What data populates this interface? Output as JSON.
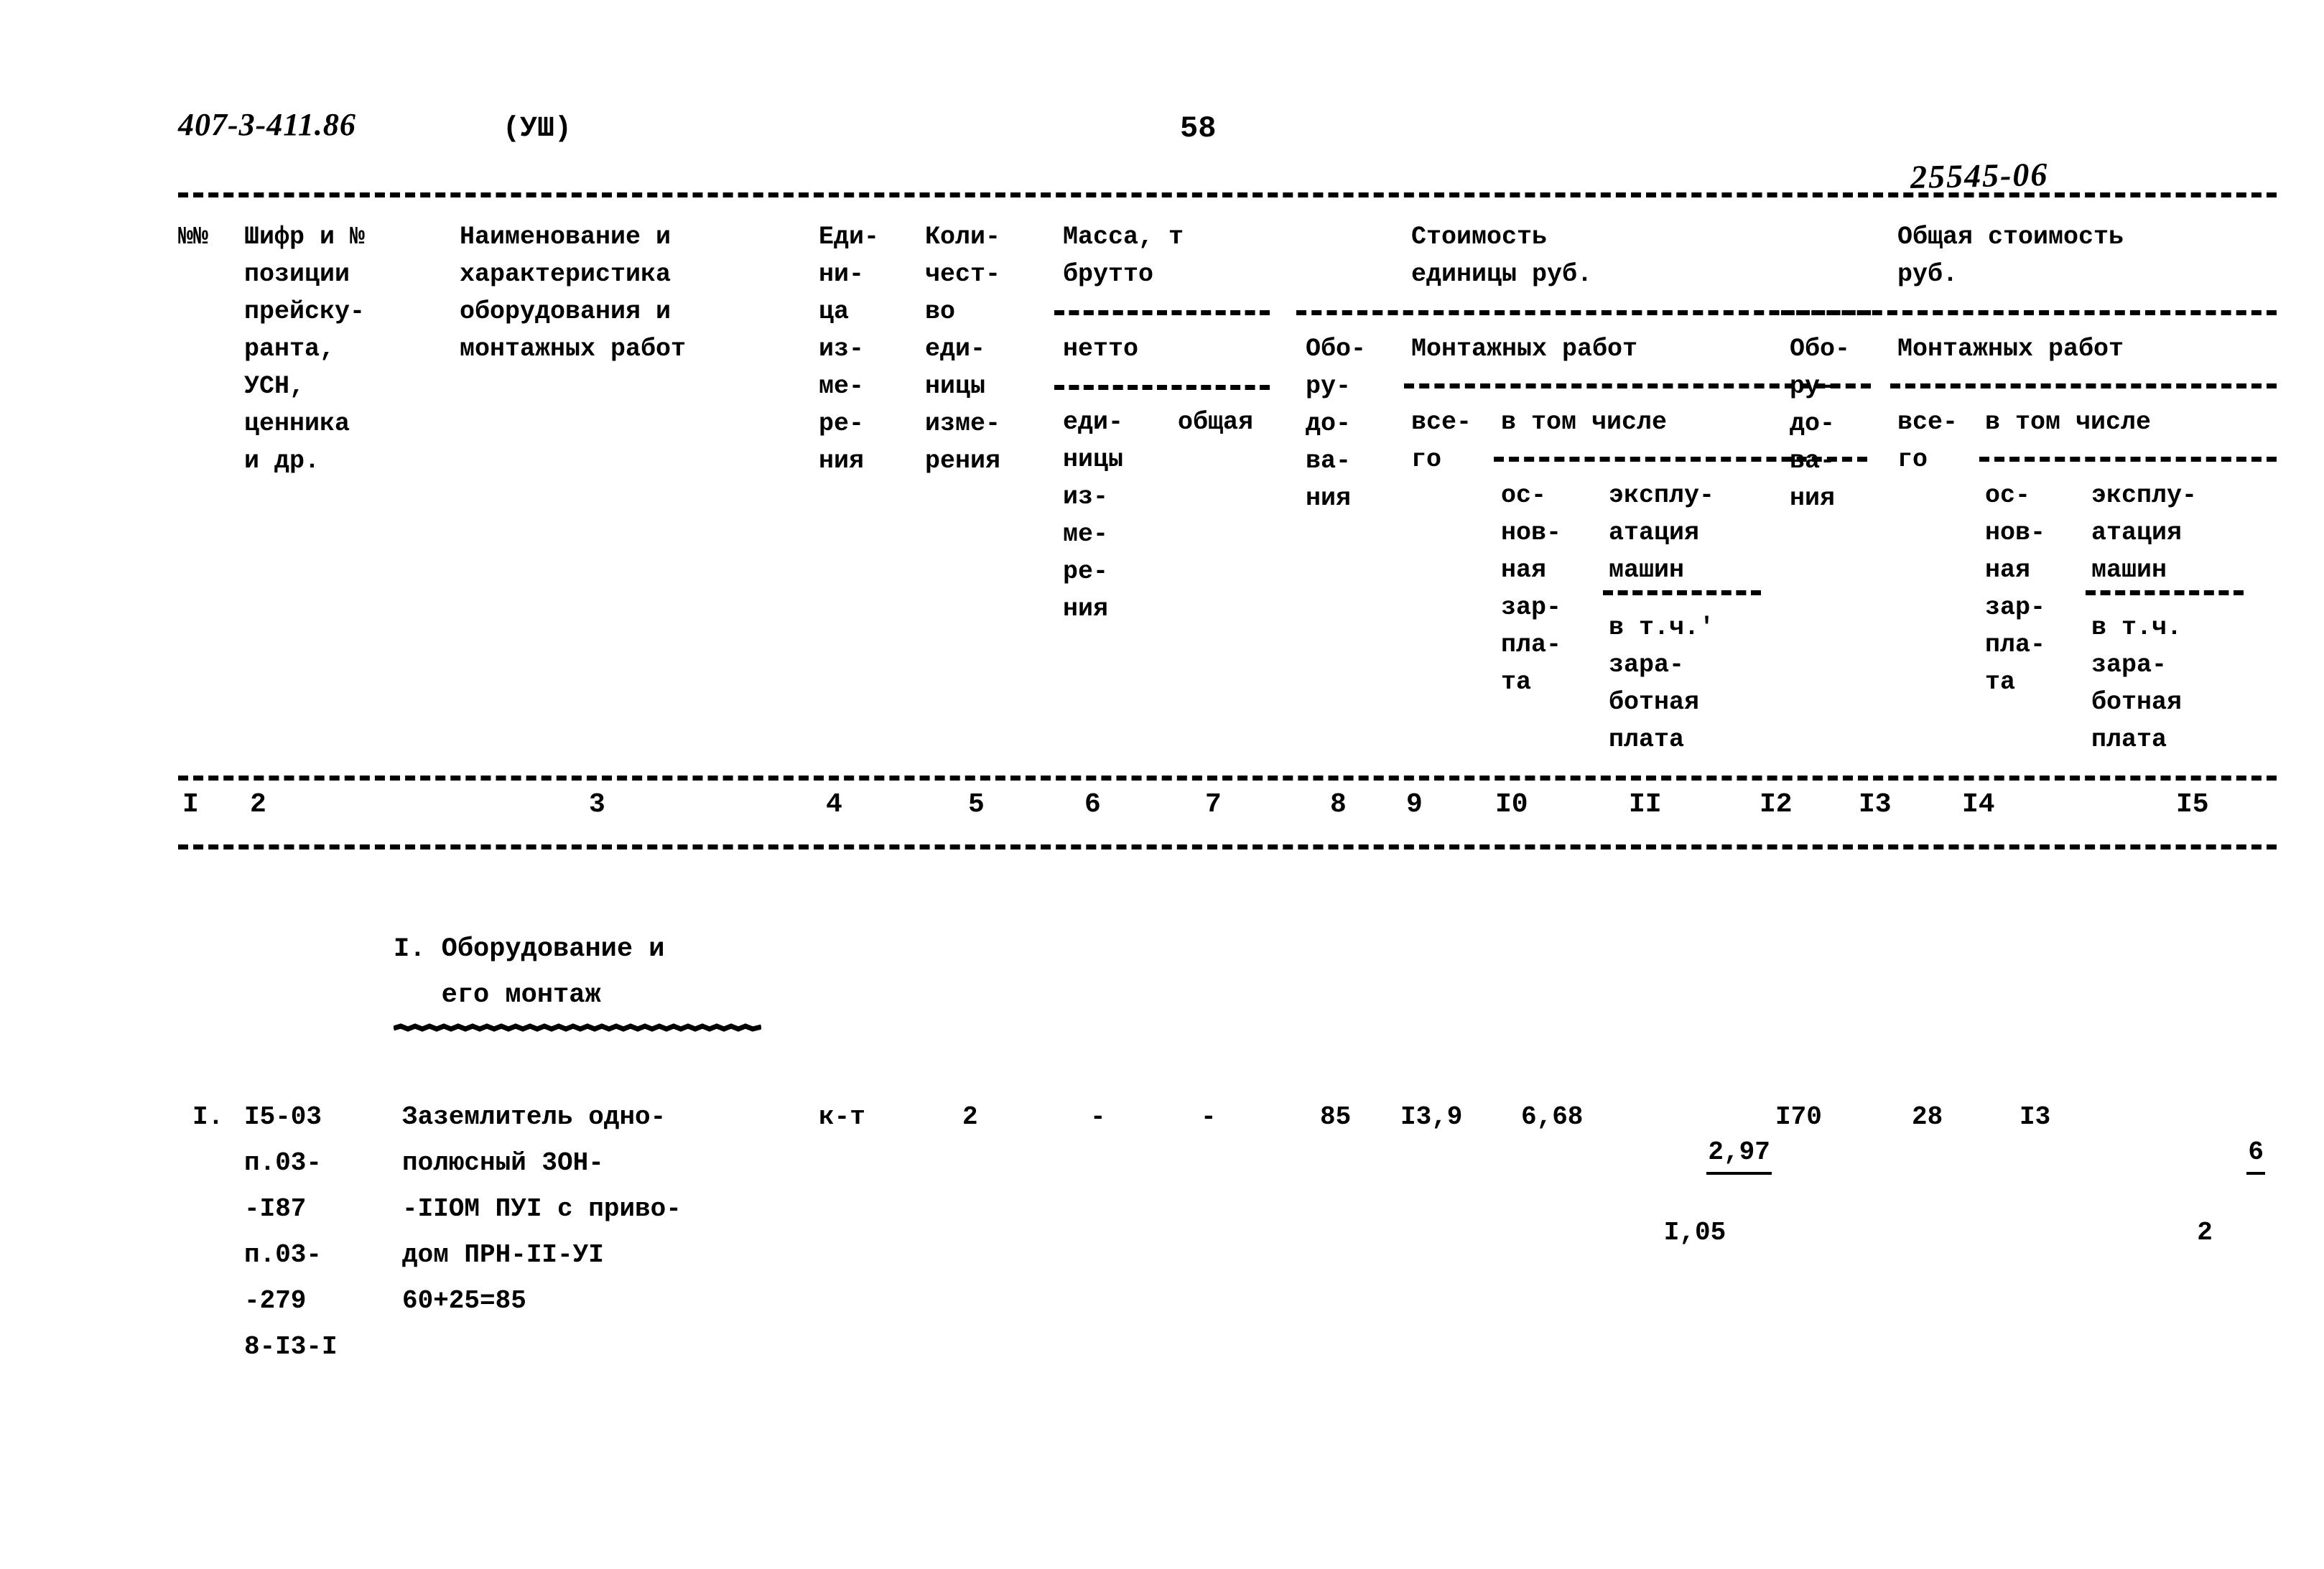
{
  "document": {
    "code": "407-3-411.86",
    "volume": "(УШ)",
    "page_number": "58",
    "archive_number": "25545-06"
  },
  "table": {
    "header_columns": {
      "col1_nn": "№№",
      "col2_code": "Шифр и №\nпозиции\nпрейску-\nранта,\nУСН,\nценника\nи др.",
      "col3_name": "Наименование и\nхарактеристика\nоборудования и\nмонтажных работ",
      "col4_unit": "Еди-\nни-\nца\nиз-\nме-\nре-\nния",
      "col5_qty": "Коли-\nчест-\nво\nеди-\nницы\nизме-\nрения",
      "mass_group_title": "Масса, т",
      "mass_brutto": "брутто",
      "mass_netto": "нетто",
      "col6_unit_mass": "еди-\nницы\nиз-\nме-\nре-\nния",
      "col7_total_mass": "общая",
      "unit_cost_title": "Стоимость\nединицы руб.",
      "col8_equipment": "Обо-\nру-\nдо-\nва-\nния",
      "montage_title": "Монтажных работ",
      "col9_total": "все-\nго",
      "in_which": "в том числе",
      "col10_basic_wage": "ос-\nнов-\nная\nзар-\nпла-\nта",
      "col11_machines": "эксплу-\nатация\nмашин",
      "col11_sub": "в т.ч.'\nзара-\nботная\nплата",
      "total_cost_title": "Общая стоимость\nруб.",
      "col12_equipment": "Обо-\nру-\nдо-\nва-\nния",
      "montage_title2": "Монтажных работ",
      "col13_total": "все-\nго",
      "in_which2": "в том числе",
      "col14_basic_wage": "ос-\nнов-\nная\nзар-\nпла-\nта",
      "col15_machines": "эксплу-\nатация\nмашин",
      "col15_sub": "в т.ч.\nзара-\nботная\nплата"
    },
    "column_numbers": [
      "I",
      "2",
      "3",
      "4",
      "5",
      "6",
      "7",
      "8",
      "9",
      "I0",
      "II",
      "I2",
      "I3",
      "I4",
      "I5"
    ],
    "section_title": "I. Оборудование и\n   его монтаж",
    "rows": [
      {
        "nn": "I.",
        "code": "I5-03\nп.03-\n-I87\nп.03-\n-279\n8-I3-I",
        "name": "Заземлитель одно-\nполюсный 3ОН-\n-IIOM ПУI с приво-\nдом ПРН-II-УI\n60+25=85",
        "unit": "к-т",
        "qty": "2",
        "mass_unit": "-",
        "mass_total": "-",
        "cost_equipment": "85",
        "cost_montage_total": "I3,9",
        "cost_basic_wage": "6,68",
        "cost_machines_num": "2,97",
        "cost_machines_den": "I,05",
        "total_equipment": "I70",
        "total_montage_total": "28",
        "total_basic_wage": "I3",
        "total_machines_num": "6",
        "total_machines_den": "2"
      }
    ]
  }
}
